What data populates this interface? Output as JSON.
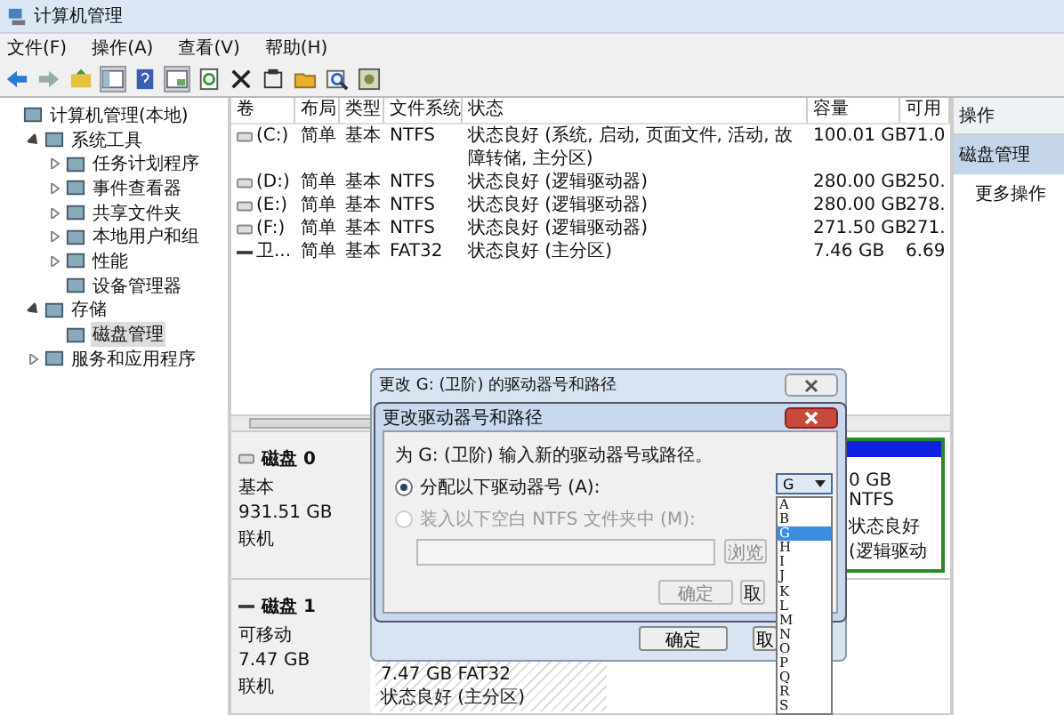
{
  "window": {
    "title": "计算机管理"
  },
  "menu": [
    "文件(F)",
    "操作(A)",
    "查看(V)",
    "帮助(H)"
  ],
  "tree": [
    {
      "label": "计算机管理(本地)",
      "selected": false,
      "children": [
        {
          "label": "系统工具",
          "expanded": true,
          "selected": false,
          "children": [
            {
              "label": "任务计划程序",
              "expanded": false,
              "selected": false
            },
            {
              "label": "事件查看器",
              "expanded": false,
              "selected": false
            },
            {
              "label": "共享文件夹",
              "expanded": false,
              "selected": false
            },
            {
              "label": "本地用户和组",
              "expanded": false,
              "selected": false
            },
            {
              "label": "性能",
              "expanded": false,
              "selected": false
            },
            {
              "label": "设备管理器",
              "selected": false
            }
          ]
        },
        {
          "label": "存储",
          "expanded": true,
          "selected": false,
          "children": [
            {
              "label": "磁盘管理",
              "selected": true
            }
          ]
        },
        {
          "label": "服务和应用程序",
          "expanded": false,
          "selected": false
        }
      ]
    }
  ],
  "table": {
    "columns": [
      "卷",
      "布局",
      "类型",
      "文件系统",
      "状态",
      "容量",
      "可用"
    ],
    "rows": [
      {
        "kind": "disk",
        "cells": [
          "(C:)",
          "简单",
          "基本",
          "NTFS",
          "状态良好 (系统, 启动, 页面文件, 活动, 故障转储, 主分区)",
          "100.01 GB",
          "71.0"
        ]
      },
      {
        "kind": "disk",
        "cells": [
          "(D:)",
          "简单",
          "基本",
          "NTFS",
          "状态良好 (逻辑驱动器)",
          "280.00 GB",
          "250."
        ]
      },
      {
        "kind": "disk",
        "cells": [
          "(E:)",
          "简单",
          "基本",
          "NTFS",
          "状态良好 (逻辑驱动器)",
          "280.00 GB",
          "278."
        ]
      },
      {
        "kind": "disk",
        "cells": [
          "(F:)",
          "简单",
          "基本",
          "NTFS",
          "状态良好 (逻辑驱动器)",
          "271.50 GB",
          "271."
        ]
      },
      {
        "kind": "usb",
        "cells": [
          "卫...",
          "简单",
          "基本",
          "FAT32",
          "状态良好 (主分区)",
          "7.46 GB",
          "6.69"
        ]
      }
    ]
  },
  "disks": [
    {
      "kind": "disk",
      "name": "磁盘 0",
      "type": "基本",
      "size": "931.51 GB",
      "status": "联机",
      "partition": [
        "0 GB NTFS",
        "状态良好 (逻辑驱动"
      ]
    },
    {
      "kind": "usb",
      "name": "磁盘 1",
      "type": "可移动",
      "size": "7.47 GB",
      "status": "联机",
      "partition": [
        "7.47 GB FAT32",
        "状态良好 (主分区)"
      ]
    }
  ],
  "actions": {
    "header": "操作",
    "items": [
      {
        "label": "磁盘管理",
        "selected": true
      },
      {
        "label": "更多操作",
        "selected": false
      }
    ]
  },
  "outer_dialog": {
    "title": "更改 G: (卫阶) 的驱动器号和路径",
    "buttons": [
      "确定",
      "取"
    ]
  },
  "inner_dialog": {
    "title": "更改驱动器号和路径",
    "prompt": "为 G: (卫阶) 输入新的驱动器号或路径。",
    "options": [
      {
        "label": "分配以下驱动器号 (A):",
        "selected": true,
        "disabled": false
      },
      {
        "label": "装入以下空白 NTFS 文件夹中 (M):",
        "selected": false,
        "disabled": true
      }
    ],
    "combo_value": "G",
    "browse": "浏览",
    "buttons": [
      "确定",
      "取"
    ]
  },
  "letters": [
    {
      "label": "A",
      "selected": false
    },
    {
      "label": "B",
      "selected": false
    },
    {
      "label": "G",
      "selected": true
    },
    {
      "label": "H",
      "selected": false
    },
    {
      "label": "I",
      "selected": false
    },
    {
      "label": "J",
      "selected": false
    },
    {
      "label": "K",
      "selected": false
    },
    {
      "label": "L",
      "selected": false
    },
    {
      "label": "M",
      "selected": false
    },
    {
      "label": "N",
      "selected": false
    },
    {
      "label": "O",
      "selected": false
    },
    {
      "label": "P",
      "selected": false
    },
    {
      "label": "Q",
      "selected": false
    },
    {
      "label": "R",
      "selected": false
    },
    {
      "label": "S",
      "selected": false
    }
  ]
}
